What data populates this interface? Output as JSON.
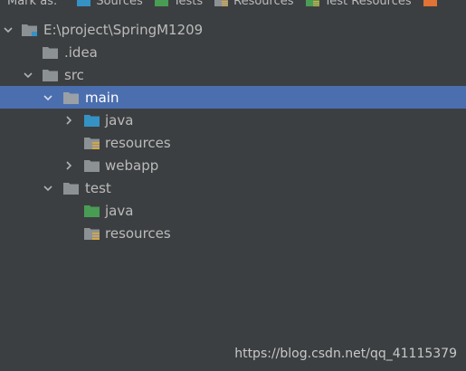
{
  "toolbar": {
    "mark_as_label": "Mark as:",
    "buttons": [
      {
        "label": "Sources",
        "icon": "sources-folder-icon",
        "color": "#3592c4"
      },
      {
        "label": "Tests",
        "icon": "tests-folder-icon",
        "color": "#499c54"
      },
      {
        "label": "Resources",
        "icon": "resources-folder-icon",
        "color": "#d4a84b"
      },
      {
        "label": "Test Resources",
        "icon": "test-resources-folder-icon",
        "color": "#d4a84b"
      },
      {
        "label": "",
        "icon": "excluded-folder-icon",
        "color": "#e07335"
      }
    ]
  },
  "tree": {
    "rows": [
      {
        "label": "E:\\project\\SpringM1209",
        "type": "module-root",
        "expanded": true,
        "selected": false
      },
      {
        "label": ".idea",
        "type": "folder",
        "expanded": null,
        "selected": false
      },
      {
        "label": "src",
        "type": "folder",
        "expanded": true,
        "selected": false
      },
      {
        "label": "main",
        "type": "folder",
        "expanded": true,
        "selected": true
      },
      {
        "label": "java",
        "type": "sources-root",
        "expanded": false,
        "selected": false
      },
      {
        "label": "resources",
        "type": "resources-root",
        "expanded": null,
        "selected": false
      },
      {
        "label": "webapp",
        "type": "folder",
        "expanded": false,
        "selected": false
      },
      {
        "label": "test",
        "type": "folder",
        "expanded": true,
        "selected": false
      },
      {
        "label": "java",
        "type": "test-sources-root",
        "expanded": null,
        "selected": false
      },
      {
        "label": "resources",
        "type": "test-resources-root",
        "expanded": null,
        "selected": false
      }
    ]
  },
  "colors": {
    "background": "#3c3f41",
    "selection": "#4b6eaf",
    "text": "#bbbbbb",
    "folder_gray": "#8c9194",
    "sources_blue": "#3592c4",
    "tests_green": "#499c54",
    "resources_orange": "#d4a84b"
  },
  "watermark": "https://blog.csdn.net/qq_41115379"
}
